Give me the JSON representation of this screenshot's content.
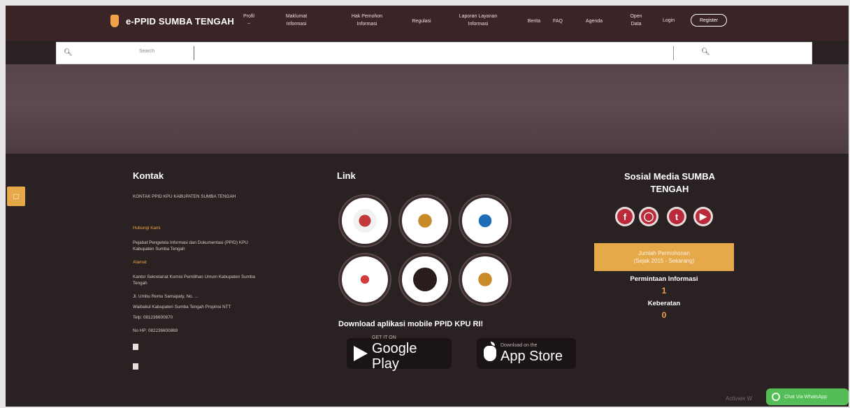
{
  "header": {
    "brand": "e-PPID SUMBA TENGAH",
    "nav": [
      {
        "label": "Profil\n~"
      },
      {
        "label": "Maklumat\nInformasi"
      },
      {
        "label": "Hak Pemohon\nInformasi"
      },
      {
        "label": "Regulasi"
      },
      {
        "label": "Laporan Layanan\nInformasi"
      },
      {
        "label": "Berita"
      },
      {
        "label": "FAQ"
      },
      {
        "label": "Agenda"
      },
      {
        "label": "Open\nData"
      }
    ],
    "login": "Login",
    "register": "Register"
  },
  "search": {
    "placeholder": "",
    "label": "Search"
  },
  "footer": {
    "kontak": {
      "title": "Kontak",
      "heading": "KONTAK PPID KPU KABUPATEN SUMBA TENGAH",
      "lines": [
        {
          "type": "orange",
          "text": "Hubungi Kami"
        },
        {
          "type": "normal",
          "text": "Pejabat Pengelola Informasi dan Dokumentasi (PPID) KPU"
        },
        {
          "type": "normal",
          "text": "Kabupaten Sumba Tengah"
        },
        {
          "type": "orange",
          "text": "Alamat"
        },
        {
          "type": "normal",
          "text": "Kantor Sekretariat Komisi Pemilihan Umum Kabupaten Sumba"
        },
        {
          "type": "normal",
          "text": "Tengah"
        },
        {
          "type": "normal",
          "text": "Jl. Umbu Remu Samapaty, No. ..."
        },
        {
          "type": "normal",
          "text": "Waibakul Kabupaten Sumba Tengah Propinsi NTT"
        },
        {
          "type": "normal",
          "text": "Telp: 081236600870"
        },
        {
          "type": "normal",
          "text": "No HP: 082236600869"
        }
      ]
    },
    "link": {
      "title": "Link",
      "download_title": "Download aplikasi mobile PPID KPU RI!",
      "google": {
        "small": "GET IT ON",
        "big": "Google Play"
      },
      "apple": {
        "small": "Download on the",
        "big": "App Store"
      }
    },
    "social": {
      "title": "Sosial Media SUMBA TENGAH",
      "icons": [
        "facebook-icon",
        "instagram-icon",
        "twitter-icon",
        "youtube-icon"
      ],
      "stats_box": {
        "line1": "Jumlah Permohonan",
        "line2": "(Sejak 2015 - Sekarang)"
      },
      "permintaan_label": "Permintaan Informasi",
      "permintaan_value": "1",
      "keberatan_label": "Keberatan",
      "keberatan_value": "0"
    },
    "whatsapp": "Chat Via WhatsApp",
    "activate": "Activate W"
  },
  "colors": {
    "nav_bg": "#3a2426",
    "accent": "#e5a94a",
    "footer_bg": "#2a2122"
  }
}
